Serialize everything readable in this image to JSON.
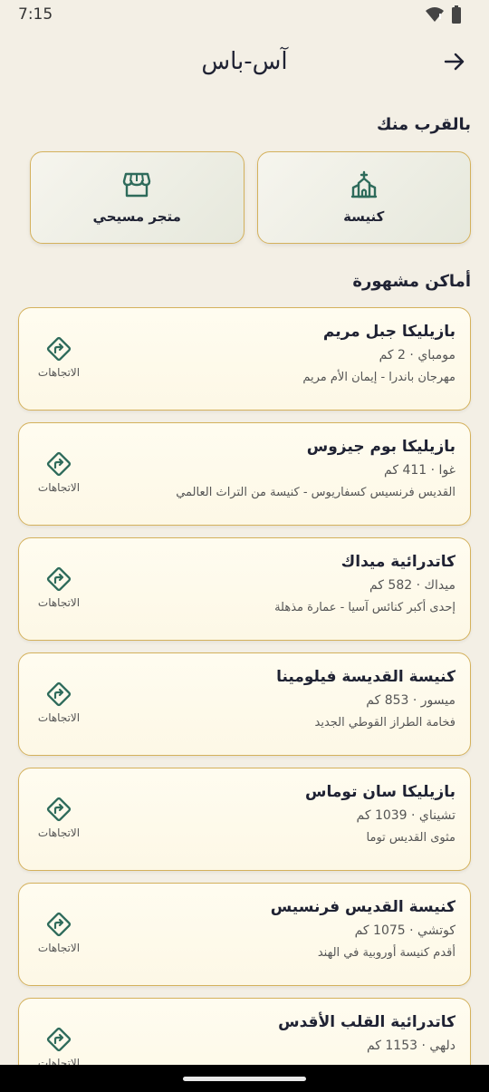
{
  "status": {
    "time": "7:15"
  },
  "appbar": {
    "title": "آس-باس"
  },
  "nearby": {
    "title": "بالقرب منك",
    "items": [
      {
        "label": "كنيسة",
        "icon": "church-icon"
      },
      {
        "label": "متجر مسيحي",
        "icon": "store-icon"
      }
    ]
  },
  "famous": {
    "title": "أماكن مشهورة",
    "directions_label": "الاتجاهات",
    "places": [
      {
        "name": "بازيليكا جبل مريم",
        "meta": "مومباي · 2 كم",
        "desc": "مهرجان باندرا - إيمان الأم مريم"
      },
      {
        "name": "بازيليكا بوم جيزوس",
        "meta": "غوا · 411 كم",
        "desc": "القديس فرنسيس كسفاريوس - كنيسة من التراث العالمي"
      },
      {
        "name": "كاتدرائية ميداك",
        "meta": "ميداك · 582 كم",
        "desc": "إحدى أكبر كنائس آسيا - عمارة مذهلة"
      },
      {
        "name": "كنيسة القديسة فيلومينا",
        "meta": "ميسور · 853 كم",
        "desc": "فخامة الطراز القوطي الجديد"
      },
      {
        "name": "بازيليكا سان توماس",
        "meta": "تشيناي · 1039 كم",
        "desc": "مثوى القديس توما"
      },
      {
        "name": "كنيسة القديس فرنسيس",
        "meta": "كوتشي · 1075 كم",
        "desc": "أقدم كنيسة أوروبية في الهند"
      },
      {
        "name": "كاتدرائية القلب الأقدس",
        "meta": "دلهي · 1153 كم",
        "desc": ""
      }
    ]
  },
  "colors": {
    "accent": "#2e6b5b",
    "border": "#d4b15c",
    "background": "#f3efe5"
  }
}
